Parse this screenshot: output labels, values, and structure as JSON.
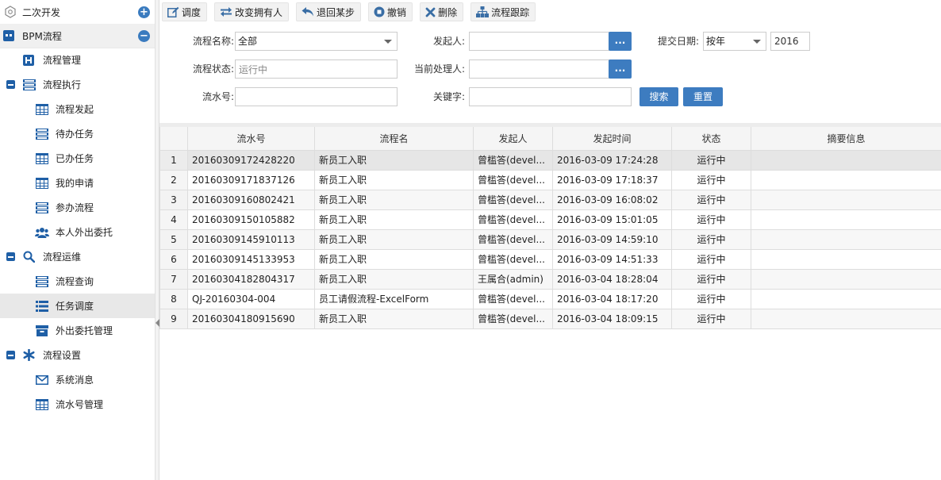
{
  "sidebar": {
    "dev_group": {
      "label": "二次开发"
    },
    "bpm_group": {
      "label": "BPM流程"
    },
    "flow_manage": {
      "label": "流程管理"
    },
    "exec_group": {
      "label": "流程执行",
      "items": [
        {
          "label": "流程发起"
        },
        {
          "label": "待办任务"
        },
        {
          "label": "已办任务"
        },
        {
          "label": "我的申请"
        },
        {
          "label": "参办流程"
        },
        {
          "label": "本人外出委托"
        }
      ]
    },
    "ops_group": {
      "label": "流程运维",
      "items": [
        {
          "label": "流程查询"
        },
        {
          "label": "任务调度"
        },
        {
          "label": "外出委托管理"
        }
      ]
    },
    "settings_group": {
      "label": "流程设置",
      "items": [
        {
          "label": "系统消息"
        },
        {
          "label": "流水号管理"
        }
      ]
    }
  },
  "toolbar": {
    "dispatch": "调度",
    "change_owner": "改变拥有人",
    "step_back": "退回某步",
    "revoke": "撤销",
    "delete": "删除",
    "trace": "流程跟踪"
  },
  "filters": {
    "flow_name_label": "流程名称:",
    "flow_name_value": "全部",
    "initiator_label": "发起人:",
    "submit_date_label": "提交日期:",
    "period_value": "按年",
    "year_value": "2016",
    "status_label": "流程状态:",
    "status_value": "运行中",
    "handler_label": "当前处理人:",
    "serial_label": "流水号:",
    "keyword_label": "关键字:",
    "dots": "...",
    "search_btn": "搜索",
    "reset_btn": "重置"
  },
  "grid": {
    "columns": [
      "流水号",
      "流程名",
      "发起人",
      "发起时间",
      "状态",
      "摘要信息"
    ],
    "rows": [
      {
        "n": "1",
        "serial": "20160309172428220",
        "flow": "新员工入职",
        "initiator": "曾槛答(devel...",
        "time": "2016-03-09 17:24:28",
        "status": "运行中",
        "summary": ""
      },
      {
        "n": "2",
        "serial": "20160309171837126",
        "flow": "新员工入职",
        "initiator": "曾槛答(devel...",
        "time": "2016-03-09 17:18:37",
        "status": "运行中",
        "summary": ""
      },
      {
        "n": "3",
        "serial": "20160309160802421",
        "flow": "新员工入职",
        "initiator": "曾槛答(devel...",
        "time": "2016-03-09 16:08:02",
        "status": "运行中",
        "summary": ""
      },
      {
        "n": "4",
        "serial": "20160309150105882",
        "flow": "新员工入职",
        "initiator": "曾槛答(devel...",
        "time": "2016-03-09 15:01:05",
        "status": "运行中",
        "summary": ""
      },
      {
        "n": "5",
        "serial": "20160309145910113",
        "flow": "新员工入职",
        "initiator": "曾槛答(devel...",
        "time": "2016-03-09 14:59:10",
        "status": "运行中",
        "summary": ""
      },
      {
        "n": "6",
        "serial": "20160309145133953",
        "flow": "新员工入职",
        "initiator": "曾槛答(devel...",
        "time": "2016-03-09 14:51:33",
        "status": "运行中",
        "summary": ""
      },
      {
        "n": "7",
        "serial": "20160304182804317",
        "flow": "新员工入职",
        "initiator": "王属合(admin)",
        "time": "2016-03-04 18:28:04",
        "status": "运行中",
        "summary": ""
      },
      {
        "n": "8",
        "serial": "QJ-20160304-004",
        "flow": "员工请假流程-ExcelForm",
        "initiator": "曾槛答(devel...",
        "time": "2016-03-04 18:17:20",
        "status": "运行中",
        "summary": ""
      },
      {
        "n": "9",
        "serial": "20160304180915690",
        "flow": "新员工入职",
        "initiator": "曾槛答(devel...",
        "time": "2016-03-04 18:09:15",
        "status": "运行中",
        "summary": ""
      }
    ]
  }
}
